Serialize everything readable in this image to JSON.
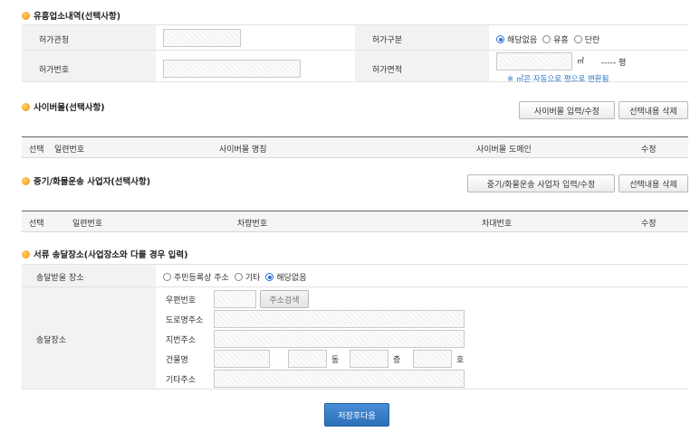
{
  "business": {
    "title": "유흥업소내역(선택사항)",
    "permit_office_label": "허가관청",
    "permit_type_label": "허가구분",
    "permit_type_options": [
      "해당없음",
      "유흥",
      "단란"
    ],
    "permit_type_selected": 0,
    "permit_number_label": "허가번호",
    "permit_area_label": "허가면적",
    "area_unit_m2": "㎡",
    "area_unit_pyeong": "----- 평",
    "area_note": "※ ㎡은 자동으로 평으로 변환됨"
  },
  "cyber_mall": {
    "title": "사이버몰(선택사항)",
    "edit_button": "사이버몰 입력/수정",
    "delete_button": "선택내용 삭제",
    "columns": [
      "선택",
      "일련번호",
      "사이버몰 명칭",
      "사이버몰 도메인",
      "수정"
    ]
  },
  "heavy_equipment": {
    "title": "중기/화물운송 사업자(선택사항)",
    "edit_button": "중기/화물운송 사업자 입력/수정",
    "delete_button": "선택내용 삭제",
    "columns": [
      "선택",
      "일련번호",
      "차량번호",
      "차대번호",
      "수정"
    ]
  },
  "delivery": {
    "title": "서류 송달장소(사업장소와 다를 경우 입력)",
    "receive_place_label": "송달받을 장소",
    "receive_options": [
      "주민등록상 주소",
      "기타",
      "해당없음"
    ],
    "receive_selected": 2,
    "place_label": "송달장소",
    "zip_label": "우편번호",
    "zip_search_button": "주소검색",
    "road_address_label": "도로명주소",
    "lot_address_label": "지번주소",
    "building_label": "건물명",
    "dong_unit": "동",
    "floor_unit": "층",
    "ho_unit": "호",
    "other_address_label": "기타주소"
  },
  "submit_button": "저장후다음"
}
